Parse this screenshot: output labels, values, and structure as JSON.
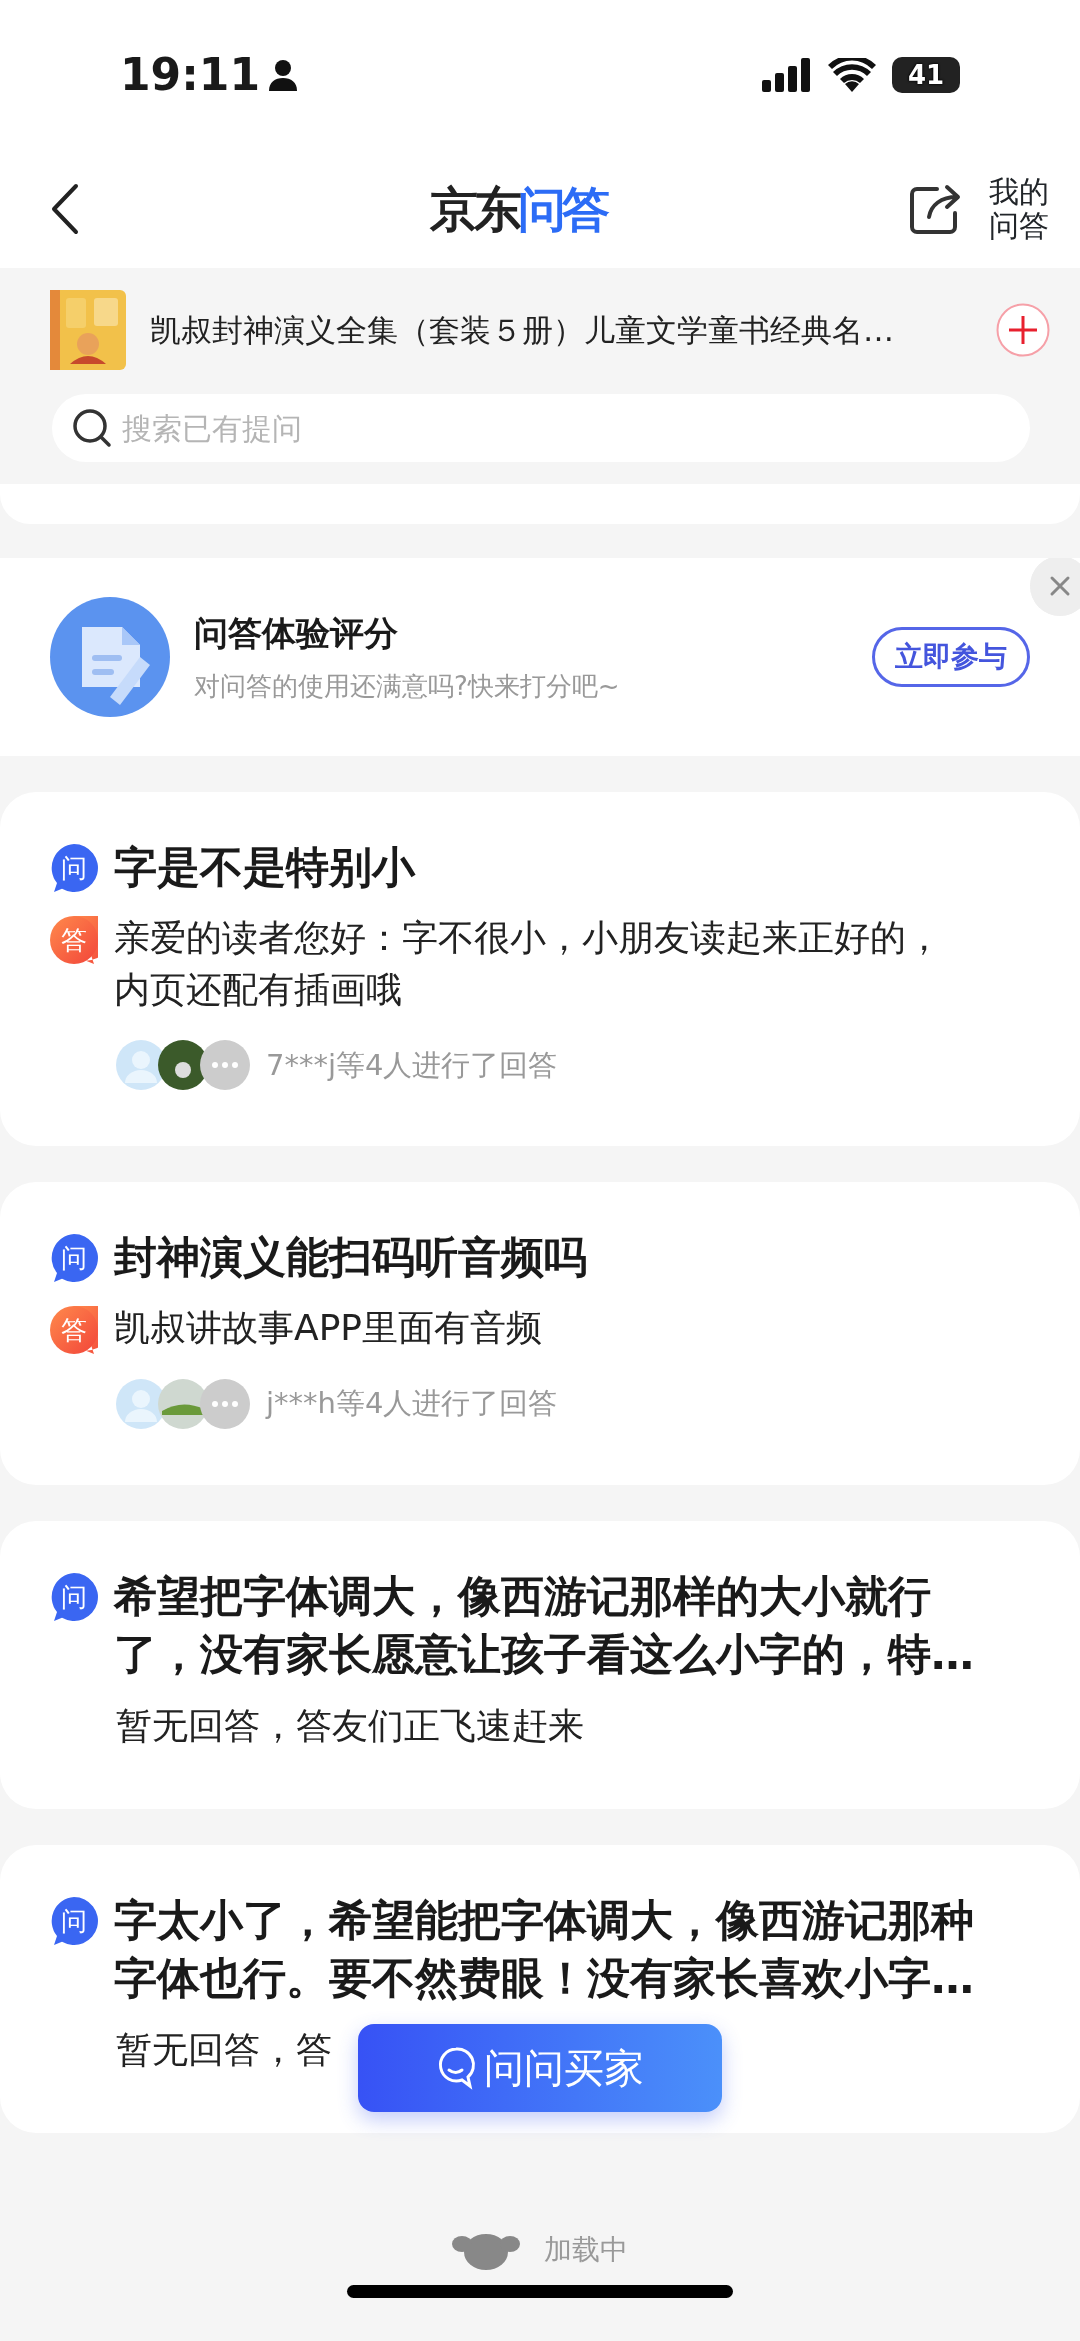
{
  "status_bar": {
    "time": "19:11",
    "battery": "41"
  },
  "nav": {
    "logo_left": "京东",
    "logo_right": "问答",
    "my_qa": "我的问答"
  },
  "product": {
    "title": "凯叔封神演义全集（套装５册）儿童文学童书经典名…"
  },
  "search": {
    "placeholder": "搜索已有提问"
  },
  "survey": {
    "title": "问答体验评分",
    "subtitle": "对问答的使用还满意吗?快来打分吧~",
    "button": "立即参与"
  },
  "questions": [
    {
      "q_badge": "问",
      "a_badge": "答",
      "question": "字是不是特别小",
      "answered": true,
      "answer": "亲爱的读者您好：字不很小，小朋友读起来正好的，内页还配有插画哦",
      "responders": "7***j等4人进行了回答"
    },
    {
      "q_badge": "问",
      "a_badge": "答",
      "question": "封神演义能扫码听音频吗",
      "answered": true,
      "answer": "凯叔讲故事APP里面有音频",
      "responders": "j***h等4人进行了回答"
    },
    {
      "q_badge": "问",
      "question": "希望把字体调大，像西游记那样的大小就行了，没有家长愿意让孩子看这么小字的，特…",
      "answered": false,
      "answer": "暂无回答，答友们正飞速赶来"
    },
    {
      "q_badge": "问",
      "question": "字太小了，希望能把字体调大，像西游记那种字体也行。要不然费眼！没有家长喜欢小字…",
      "answered": false,
      "answer": "暂无回答，答"
    }
  ],
  "ask_button": "问问买家",
  "loading": "加载中"
}
